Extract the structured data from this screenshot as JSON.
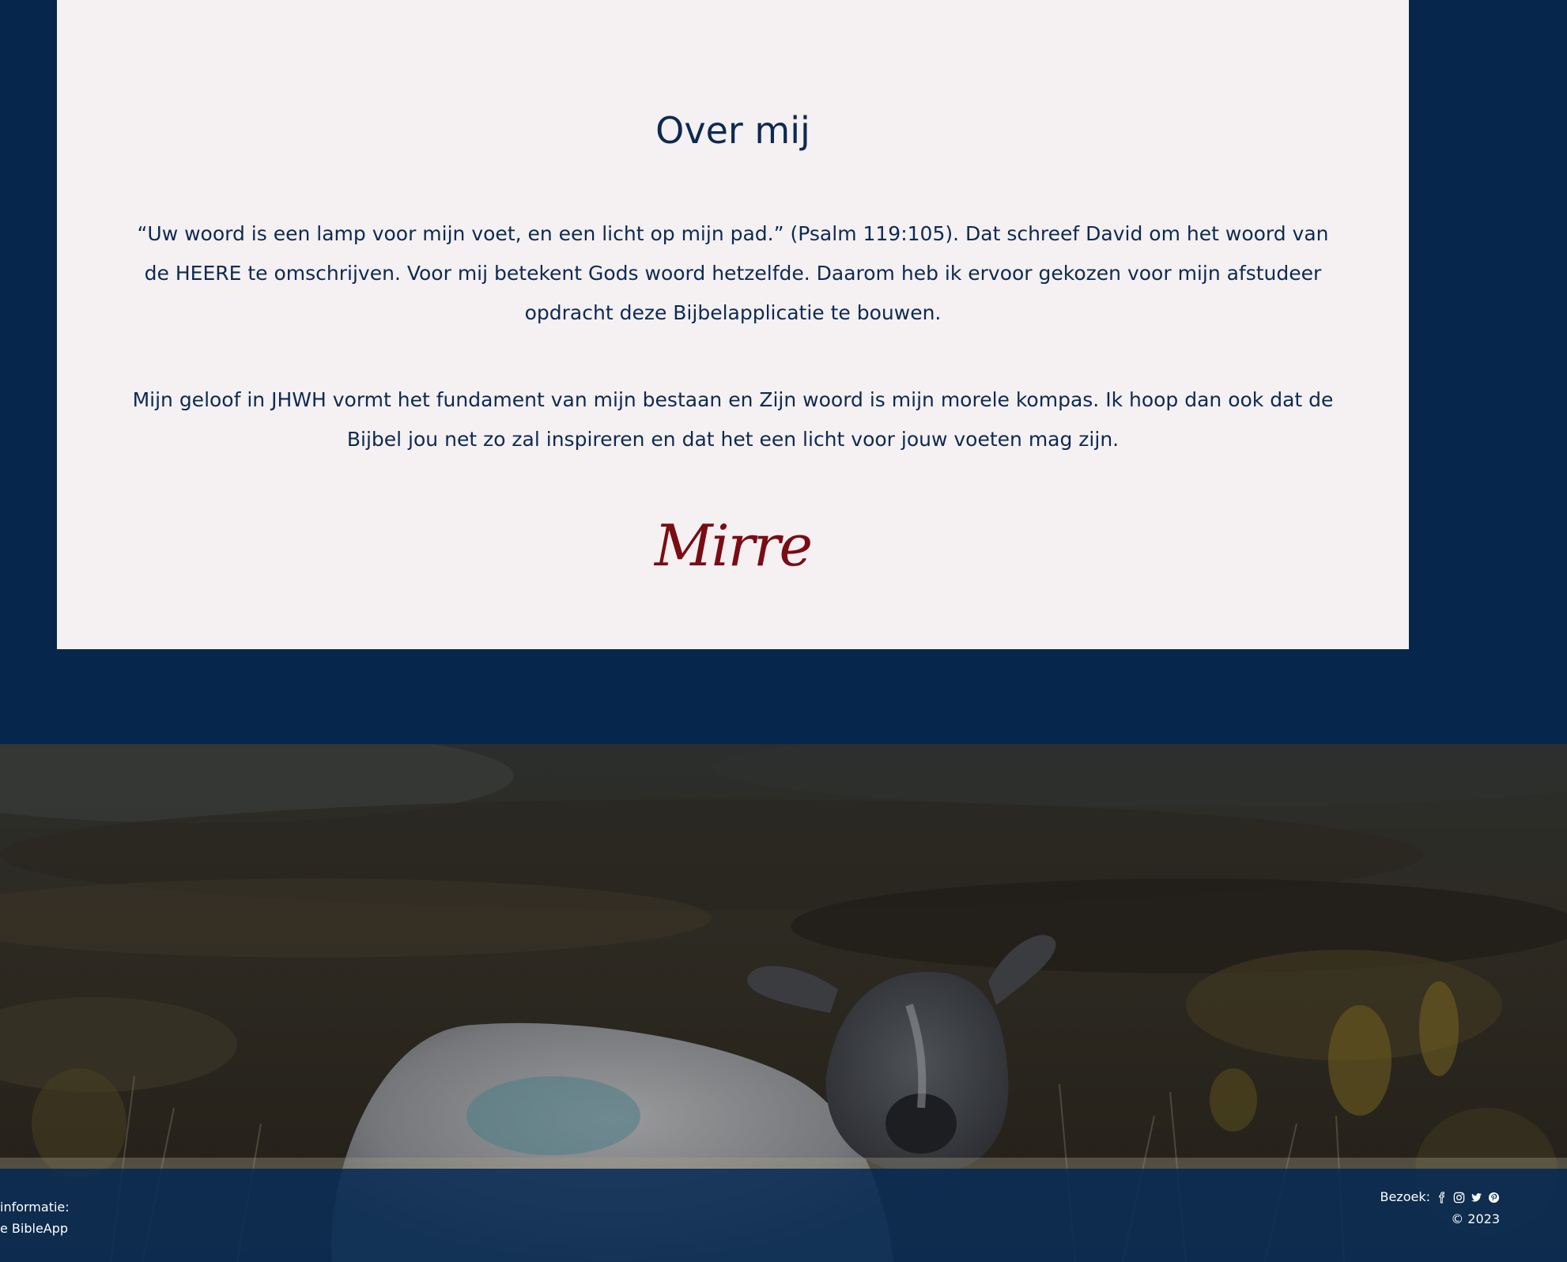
{
  "about": {
    "title": "Over mij",
    "paragraph1": "“Uw woord is een lamp voor mijn voet, en een licht op mijn pad.” (Psalm 119:105). Dat schreef David om het woord van de HEERE te omschrijven. Voor mij betekent Gods woord hetzelfde. Daarom heb ik ervoor gekozen voor mijn afstudeer opdracht deze Bijbelapplicatie te bouwen.",
    "paragraph2": "Mijn geloof in JHWH vormt het fundament van mijn bestaan en Zijn woord is mijn morele kompas. Ik hoop dan ook dat de Bijbel jou net zo zal inspireren en dat het een licht voor jouw voeten mag zijn.",
    "signature": "Mirre"
  },
  "footer": {
    "left_line1": "informatie:",
    "left_line2": "e BibleApp",
    "visit_label": "Bezoek:",
    "social_icons": [
      "facebook-icon",
      "instagram-icon",
      "twitter-icon",
      "pinterest-icon"
    ],
    "copyright": "© 2023"
  },
  "colors": {
    "page_background": "#07264c",
    "card_background": "#f5f0f1",
    "heading_text": "#0c2a52",
    "signature": "#7a0c15"
  }
}
